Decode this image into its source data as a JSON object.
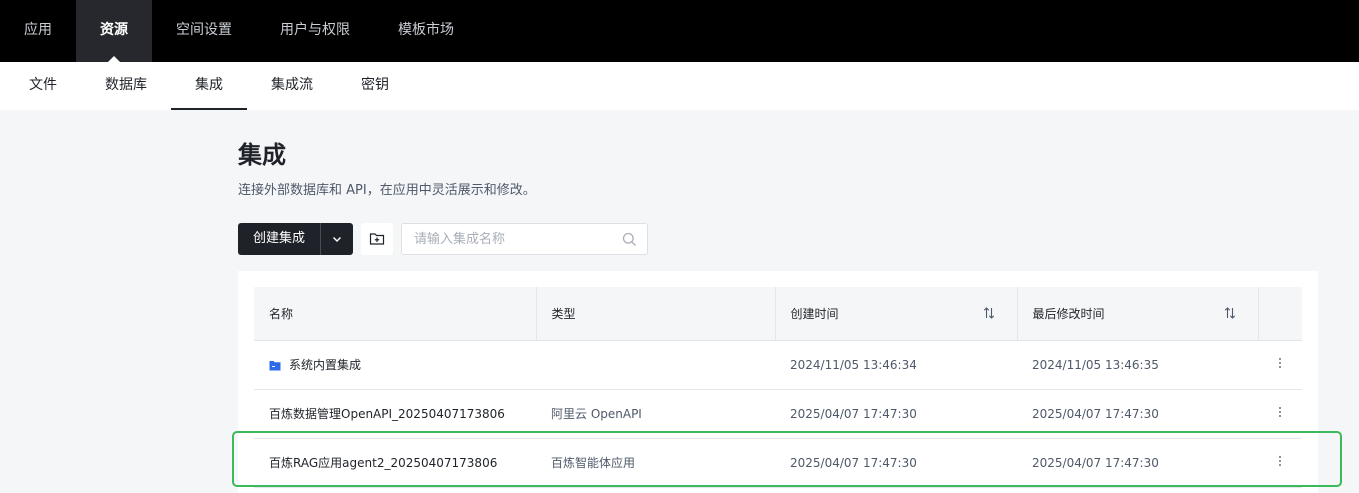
{
  "top_nav": [
    {
      "label": "应用",
      "active": false
    },
    {
      "label": "资源",
      "active": true
    },
    {
      "label": "空间设置",
      "active": false
    },
    {
      "label": "用户与权限",
      "active": false
    },
    {
      "label": "模板市场",
      "active": false
    }
  ],
  "sub_nav": [
    {
      "label": "文件",
      "active": false
    },
    {
      "label": "数据库",
      "active": false
    },
    {
      "label": "集成",
      "active": true
    },
    {
      "label": "集成流",
      "active": false
    },
    {
      "label": "密钥",
      "active": false
    }
  ],
  "page": {
    "title": "集成",
    "description": "连接外部数据库和 API，在应用中灵活展示和修改。"
  },
  "toolbar": {
    "create_label": "创建集成",
    "search_placeholder": "请输入集成名称",
    "search_value": ""
  },
  "table": {
    "columns": {
      "name": "名称",
      "type": "类型",
      "created": "创建时间",
      "modified": "最后修改时间"
    },
    "rows": [
      {
        "name": "系统内置集成",
        "type": "",
        "created": "2024/11/05 13:46:34",
        "modified": "2024/11/05 13:46:35",
        "is_folder": true
      },
      {
        "name": "百炼数据管理OpenAPI_20250407173806",
        "type": "阿里云 OpenAPI",
        "created": "2025/04/07 17:47:30",
        "modified": "2025/04/07 17:47:30",
        "is_folder": false
      },
      {
        "name": "百炼RAG应用agent2_20250407173806",
        "type": "百炼智能体应用",
        "created": "2025/04/07 17:47:30",
        "modified": "2025/04/07 17:47:30",
        "is_folder": false
      }
    ]
  },
  "colors": {
    "accent": "#1f2329",
    "folder_icon": "#2f6be6",
    "highlight": "#3cb95a"
  },
  "icons": {
    "caret": "chevron-down-icon",
    "folder_add": "folder-add-icon",
    "search": "search-icon",
    "sort": "sort-icon",
    "more": "more-vertical-icon",
    "folder": "folder-icon"
  }
}
